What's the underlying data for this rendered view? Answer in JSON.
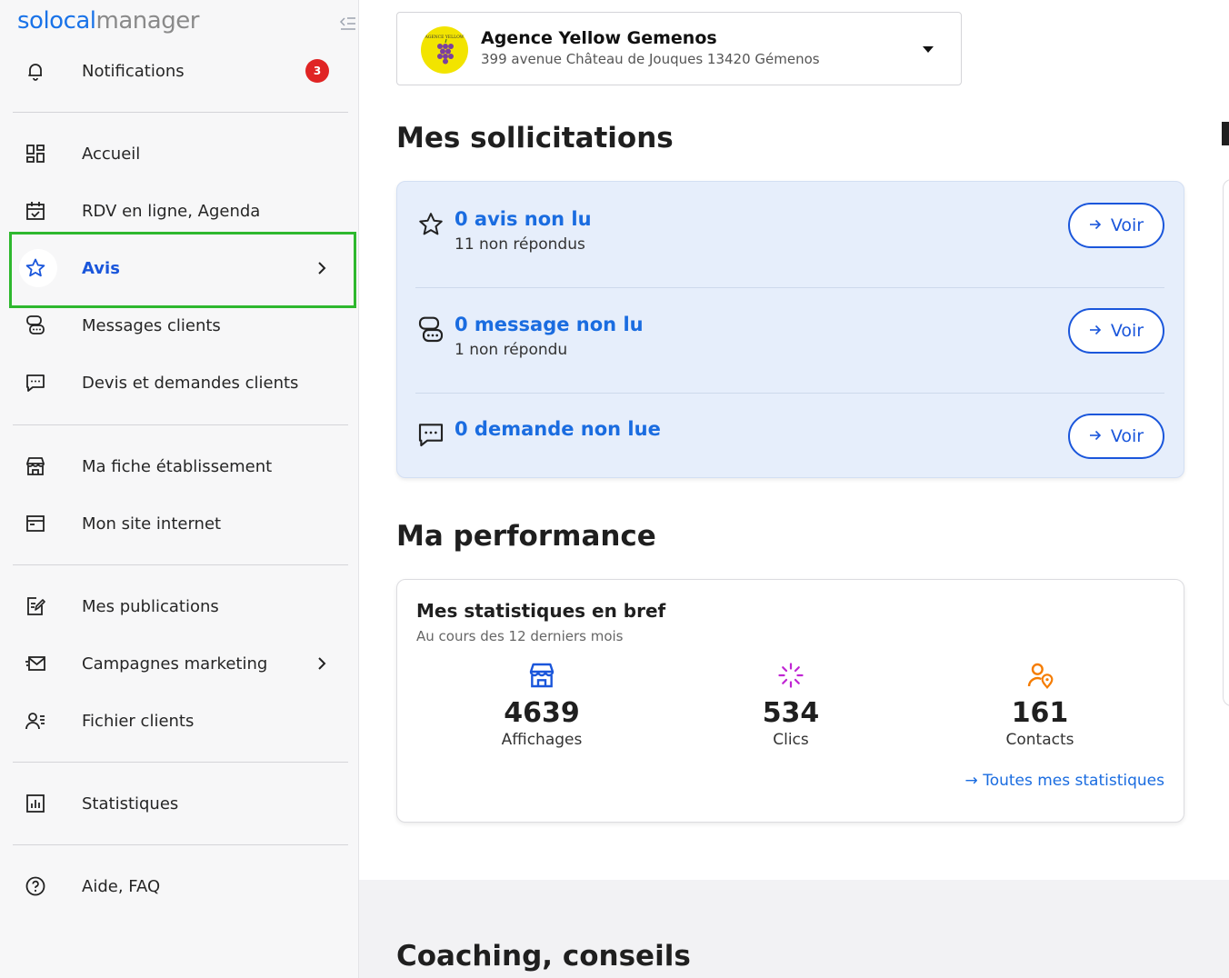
{
  "app": {
    "logo_part1": "solocal",
    "logo_part2": "manager"
  },
  "sidebar": {
    "notifications": {
      "label": "Notifications",
      "count": "3"
    },
    "items": [
      {
        "label": "Accueil"
      },
      {
        "label": "RDV en ligne, Agenda"
      },
      {
        "label": "Avis"
      },
      {
        "label": "Messages clients"
      },
      {
        "label": "Devis et demandes clients"
      },
      {
        "label": "Ma fiche établissement"
      },
      {
        "label": "Mon site internet"
      },
      {
        "label": "Mes publications"
      },
      {
        "label": "Campagnes marketing"
      },
      {
        "label": "Fichier clients"
      },
      {
        "label": "Statistiques"
      },
      {
        "label": "Aide, FAQ"
      }
    ]
  },
  "agency": {
    "logo_text": "AGENCE YELLOW",
    "name": "Agence Yellow Gemenos",
    "address": "399 avenue Château de Jouques 13420 Gémenos"
  },
  "solicitations": {
    "title": "Mes sollicitations",
    "rows": [
      {
        "title": "0 avis non lu",
        "subtitle": "11 non répondus",
        "button": "Voir",
        "icon": "star-icon"
      },
      {
        "title": "0 message non lu",
        "subtitle": "1 non répondu",
        "button": "Voir",
        "icon": "chat-bubbles-icon"
      },
      {
        "title": "0 demande non lue",
        "subtitle": "",
        "button": "Voir",
        "icon": "message-dots-icon"
      }
    ]
  },
  "performance": {
    "title": "Ma performance",
    "card_title": "Mes statistiques en bref",
    "card_subtitle": "Au cours des 12 derniers mois",
    "stats": [
      {
        "value": "4639",
        "label": "Affichages",
        "icon": "storefront-icon",
        "color": "#1a56db"
      },
      {
        "value": "534",
        "label": "Clics",
        "icon": "click-burst-icon",
        "color": "#c026d3"
      },
      {
        "value": "161",
        "label": "Contacts",
        "icon": "contact-pin-icon",
        "color": "#f57c00"
      }
    ],
    "link": "→ Toutes mes statistiques"
  },
  "coaching": {
    "title": "Coaching, conseils"
  },
  "colors": {
    "accent": "#1a56db",
    "link": "#1a6ce0",
    "badge": "#e02424",
    "highlight": "#2eb82e",
    "panel": "#e6eefb"
  }
}
